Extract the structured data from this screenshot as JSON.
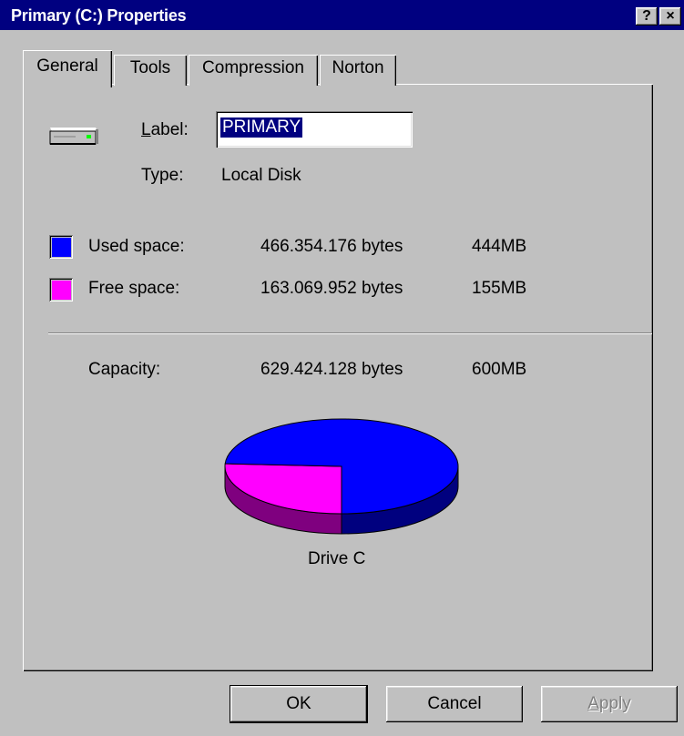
{
  "window": {
    "title": "Primary (C:) Properties",
    "help_button": "?",
    "close_button": "×"
  },
  "tabs": [
    {
      "label": "General",
      "active": true
    },
    {
      "label": "Tools",
      "active": false
    },
    {
      "label": "Compression",
      "active": false
    },
    {
      "label": "Norton",
      "active": false
    }
  ],
  "general": {
    "drive_icon": "hard-drive-icon",
    "label_caption_prefix": "L",
    "label_caption_rest": "abel:",
    "label_value": "PRIMARY",
    "type_caption": "Type:",
    "type_value": "Local Disk",
    "used": {
      "caption": "Used space:",
      "bytes": "466.354.176 bytes",
      "size": "444MB",
      "color": "#0000ff"
    },
    "free": {
      "caption": "Free space:",
      "bytes": "163.069.952 bytes",
      "size": "155MB",
      "color": "#ff00ff"
    },
    "capacity": {
      "caption": "Capacity:",
      "bytes": "629.424.128 bytes",
      "size": "600MB"
    },
    "drive_caption": "Drive C"
  },
  "chart_data": {
    "type": "pie",
    "title": "",
    "series": [
      {
        "name": "Used space",
        "value": 466354176,
        "color": "#0000ff",
        "shade": "#00007f"
      },
      {
        "name": "Free space",
        "value": 163069952,
        "color": "#ff00ff",
        "shade": "#7f007f"
      }
    ],
    "style": "3d"
  },
  "buttons": {
    "ok": "OK",
    "cancel": "Cancel",
    "apply_prefix": "A",
    "apply_rest": "pply"
  }
}
